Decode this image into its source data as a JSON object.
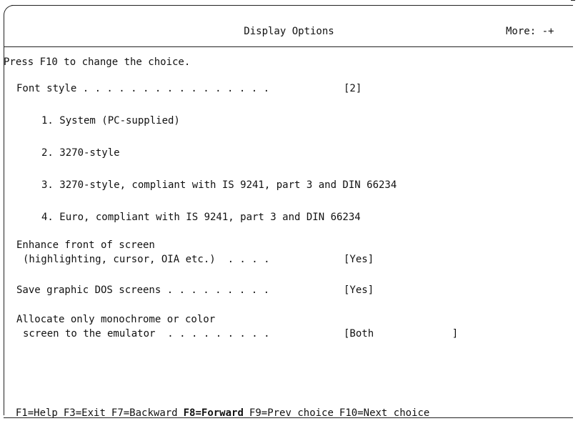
{
  "header": {
    "title": "Display Options",
    "more_indicator": "More: -+"
  },
  "instruction": "Press F10 to change the choice.",
  "font_style": {
    "label": "Font style . . . . . . . . . . . . . . . .",
    "value": "[2]",
    "options": [
      "1. System (PC-supplied)",
      "2. 3270-style",
      "3. 3270-style, compliant with IS 9241, part 3 and DIN 66234",
      "4. Euro, compliant with IS 9241, part 3 and DIN 66234"
    ]
  },
  "enhance_front": {
    "label_line1": "Enhance front of screen",
    "label_line2": "(highlighting, cursor, OIA etc.)  . . . .",
    "value": "[Yes]"
  },
  "save_graphic": {
    "label": "Save graphic DOS screens . . . . . . . . .",
    "value": "[Yes]"
  },
  "allocate_screen": {
    "label_line1": "Allocate only monochrome or color",
    "label_line2": "screen to the emulator  . . . . . . . . .",
    "value": "[Both             ]"
  },
  "function_keys": [
    {
      "label": "F1=Help",
      "active": false
    },
    {
      "label": "F3=Exit",
      "active": false
    },
    {
      "label": "F7=Backward",
      "active": false
    },
    {
      "label": "F8=Forward",
      "active": true
    },
    {
      "label": "F9=Prev choice",
      "active": false
    },
    {
      "label": "F10=Next choice",
      "active": false
    }
  ]
}
